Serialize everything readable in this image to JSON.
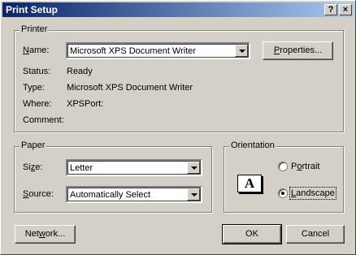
{
  "window": {
    "title": "Print Setup",
    "help_label": "?",
    "close_label": "×"
  },
  "printer": {
    "group_label": "Printer",
    "name_label_u": "N",
    "name_label_rest": "ame:",
    "name_value": "Microsoft XPS Document Writer",
    "properties_u": "P",
    "properties_rest": "roperties...",
    "status_label": "Status:",
    "status_value": "Ready",
    "type_label": "Type:",
    "type_value": "Microsoft XPS Document Writer",
    "where_label": "Where:",
    "where_value": "XPSPort:",
    "comment_label": "Comment:"
  },
  "paper": {
    "group_label": "Paper",
    "size_label_pre": "Si",
    "size_label_u": "z",
    "size_label_rest": "e:",
    "size_value": "Letter",
    "source_label_u": "S",
    "source_label_rest": "ource:",
    "source_value": "Automatically Select"
  },
  "orientation": {
    "group_label": "Orientation",
    "icon_letter": "A",
    "portrait_u": "o",
    "portrait_pre": "P",
    "portrait_rest": "rtrait",
    "landscape_u": "L",
    "landscape_rest": "andscape",
    "selected": "landscape"
  },
  "buttons": {
    "network_pre": "Net",
    "network_u": "w",
    "network_rest": "ork...",
    "ok": "OK",
    "cancel": "Cancel"
  }
}
